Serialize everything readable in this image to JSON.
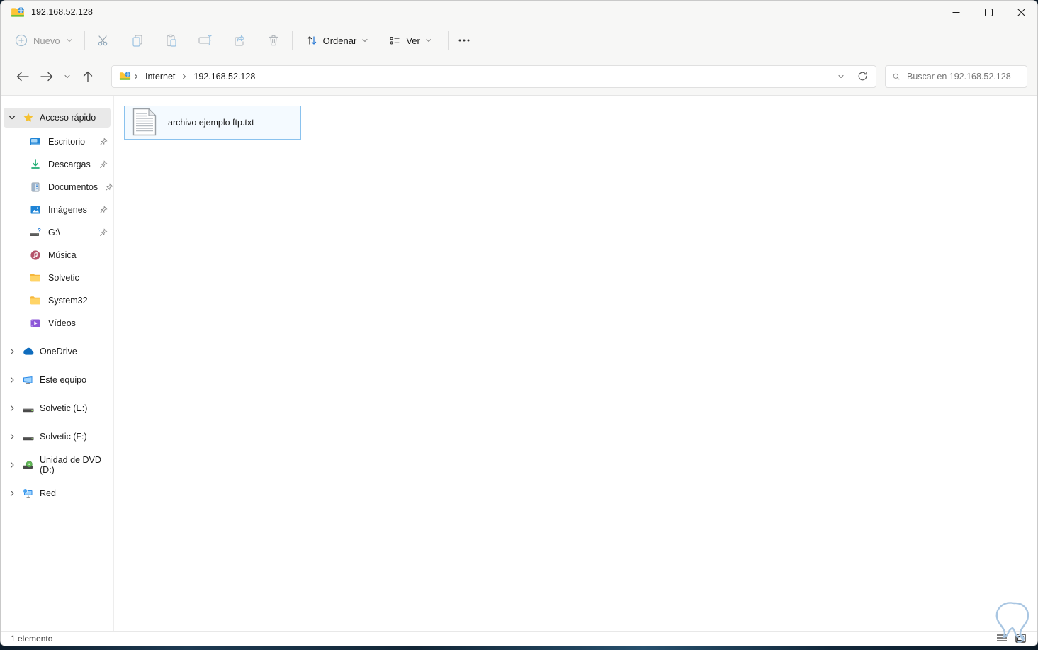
{
  "window": {
    "title": "192.168.52.128"
  },
  "toolbar": {
    "new_label": "Nuevo",
    "sort_label": "Ordenar",
    "view_label": "Ver"
  },
  "navbar": {
    "breadcrumb_root": "Internet",
    "breadcrumb_current": "192.168.52.128",
    "search_placeholder": "Buscar en 192.168.52.128"
  },
  "sidebar": {
    "quick_access_label": "Acceso rápido",
    "quick_access_items": [
      {
        "label": "Escritorio",
        "icon": "desktop-icon",
        "pinned": true
      },
      {
        "label": "Descargas",
        "icon": "downloads-icon",
        "pinned": true
      },
      {
        "label": "Documentos",
        "icon": "documents-icon",
        "pinned": true
      },
      {
        "label": "Imágenes",
        "icon": "pictures-icon",
        "pinned": true
      },
      {
        "label": "G:\\",
        "icon": "network-drive-icon",
        "pinned": true
      },
      {
        "label": "Música",
        "icon": "music-icon",
        "pinned": false
      },
      {
        "label": "Solvetic",
        "icon": "folder-icon",
        "pinned": false
      },
      {
        "label": "System32",
        "icon": "folder-icon",
        "pinned": false
      },
      {
        "label": "Vídeos",
        "icon": "videos-icon",
        "pinned": false
      }
    ],
    "tree_items": [
      {
        "label": "OneDrive",
        "icon": "onedrive-cloud-icon"
      },
      {
        "label": "Este equipo",
        "icon": "computer-icon"
      },
      {
        "label": "Solvetic (E:)",
        "icon": "harddrive-icon"
      },
      {
        "label": "Solvetic (F:)",
        "icon": "harddrive-icon"
      },
      {
        "label": "Unidad de DVD (D:)",
        "icon": "dvd-drive-icon"
      },
      {
        "label": "Red",
        "icon": "network-icon"
      }
    ]
  },
  "content": {
    "file_name": "archivo ejemplo ftp.txt",
    "file_icon": "text-file-icon",
    "file_selected": true
  },
  "statusbar": {
    "items_count": "1 elemento"
  },
  "colors": {
    "accent_blue": "#0078d4",
    "selection_border": "#8ac2ee",
    "selection_bg": "#f4faff",
    "folder_yellow": "#fdc435",
    "star_gold": "#f5c131",
    "chrome_bg": "#f7f7f6"
  }
}
